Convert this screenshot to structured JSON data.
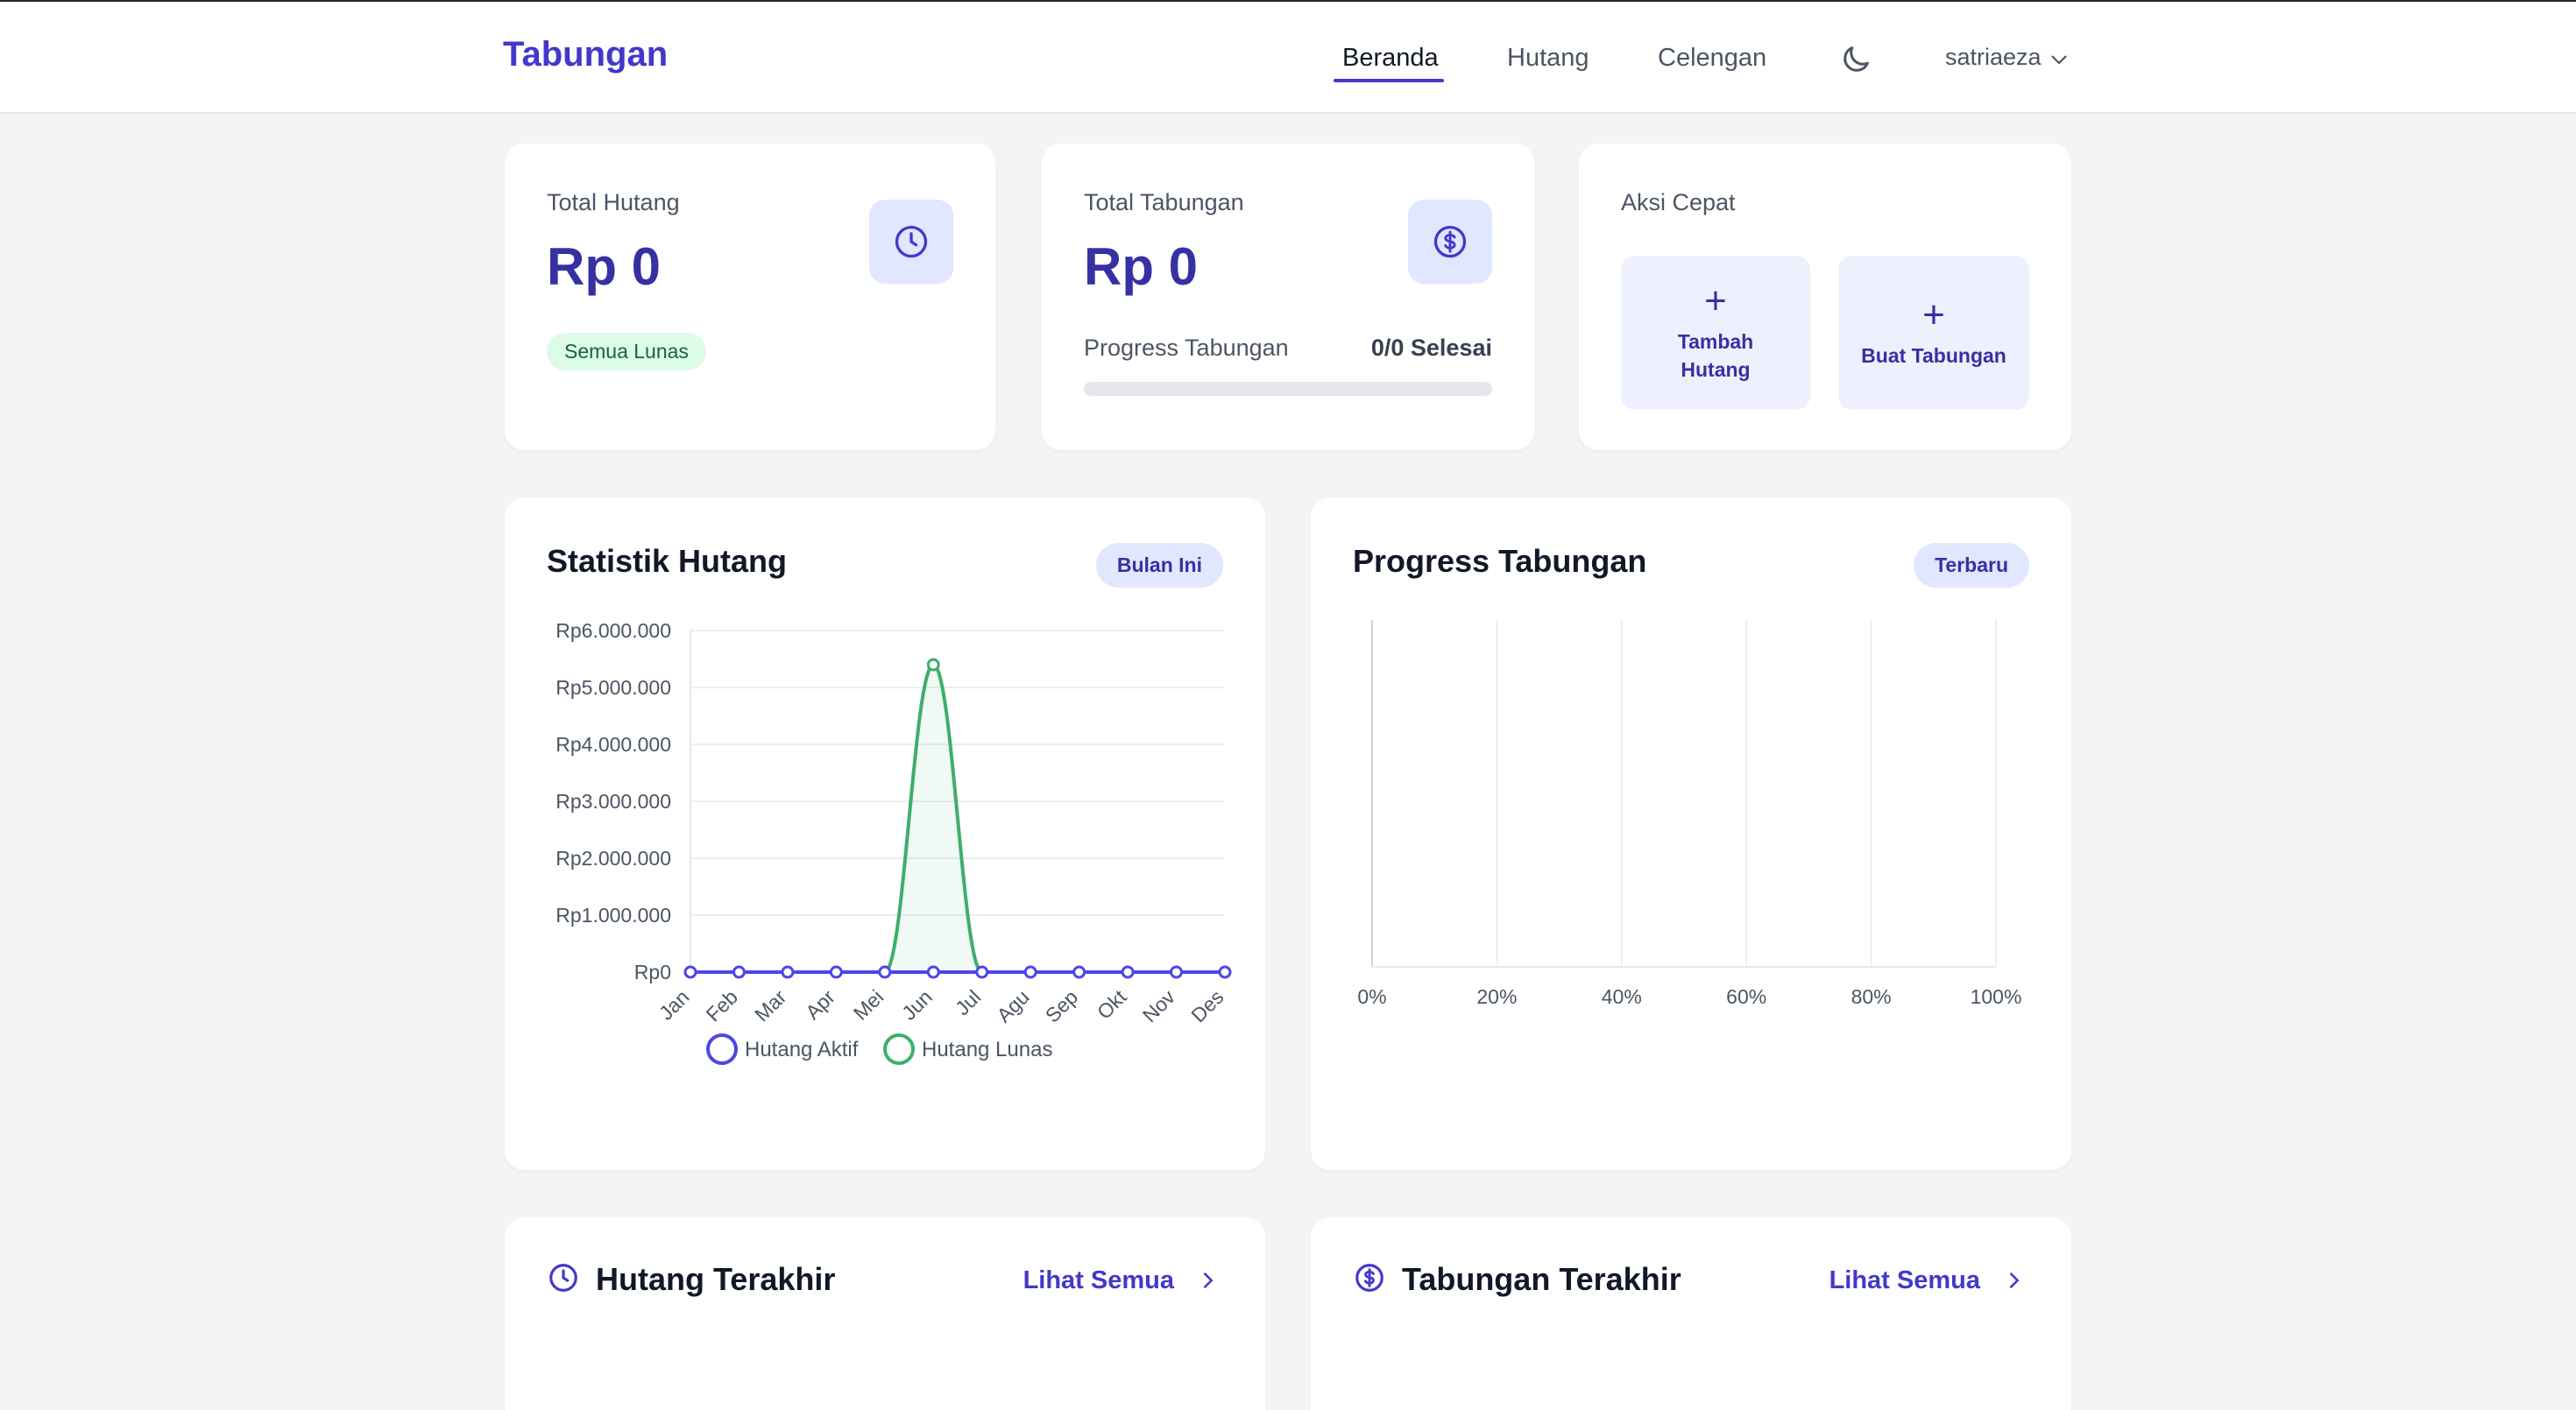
{
  "nav": {
    "brand": "Tabungan",
    "links": [
      "Beranda",
      "Hutang",
      "Celengan"
    ],
    "user": "satriaeza"
  },
  "summary": {
    "debt": {
      "label": "Total Hutang",
      "value": "Rp 0",
      "badge": "Semua Lunas"
    },
    "savings": {
      "label": "Total Tabungan",
      "value": "Rp 0",
      "progress_label": "Progress Tabungan",
      "progress_text": "0/0 Selesai",
      "progress_fraction": 0
    },
    "quick": {
      "label": "Aksi Cepat",
      "add_debt_line1": "Tambah",
      "add_debt_line2": "Hutang",
      "create_savings": "Buat Tabungan"
    }
  },
  "debt_chart": {
    "title": "Statistik Hutang",
    "filter": "Bulan Ini"
  },
  "savings_chart": {
    "title": "Progress Tabungan",
    "filter": "Terbaru"
  },
  "recent_debt": {
    "title": "Hutang Terakhir",
    "link": "Lihat Semua"
  },
  "recent_savings": {
    "title": "Tabungan Terakhir",
    "link": "Lihat Semua"
  },
  "colors": {
    "accent": "#4338ca",
    "active_series": "#4f46e5",
    "paid_series": "#3fae6b"
  },
  "chart_data": [
    {
      "type": "line",
      "title": "",
      "categories": [
        "Jan",
        "Feb",
        "Mar",
        "Apr",
        "Mei",
        "Jun",
        "Jul",
        "Agu",
        "Sep",
        "Okt",
        "Nov",
        "Des"
      ],
      "series": [
        {
          "name": "Hutang Aktif",
          "values": [
            0,
            0,
            0,
            0,
            0,
            0,
            0,
            0,
            0,
            0,
            0,
            0
          ]
        },
        {
          "name": "Hutang Lunas",
          "values": [
            0,
            0,
            0,
            0,
            0,
            5400000,
            0,
            0,
            0,
            0,
            0,
            0
          ]
        }
      ],
      "ytick_labels": [
        "Rp0",
        "Rp1.000.000",
        "Rp2.000.000",
        "Rp3.000.000",
        "Rp4.000.000",
        "Rp5.000.000",
        "Rp6.000.000"
      ],
      "ylim": [
        0,
        6000000
      ],
      "legend": "bottom",
      "grid": true
    },
    {
      "type": "bar",
      "title": "",
      "categories": [],
      "values": [],
      "xtick_labels": [
        "0%",
        "20%",
        "40%",
        "60%",
        "80%",
        "100%"
      ],
      "xlim": [
        0,
        100
      ],
      "grid": true
    }
  ]
}
